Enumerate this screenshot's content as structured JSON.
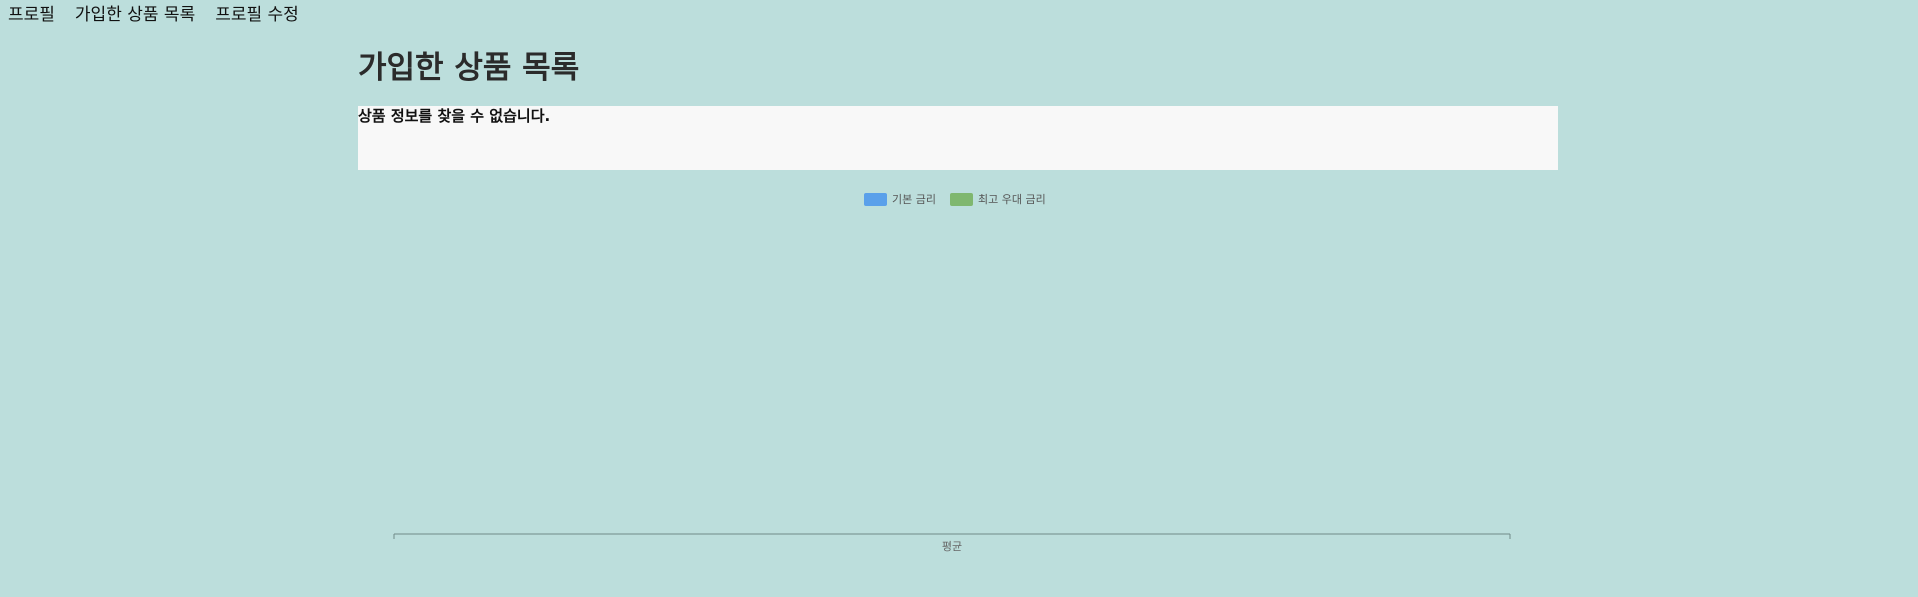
{
  "nav": {
    "items": [
      {
        "label": "프로필"
      },
      {
        "label": "가입한 상품 목록"
      },
      {
        "label": "프로필 수정"
      }
    ]
  },
  "page": {
    "title": "가입한 상품 목록",
    "message": "상품 정보를 찾을 수 없습니다."
  },
  "colors": {
    "background": "#bcdedc",
    "panel": "#f8f8f8",
    "base_rate": "#5aa0ea",
    "max_rate": "#7fb76f"
  },
  "chart_data": {
    "type": "bar",
    "categories": [
      "평균"
    ],
    "series": [
      {
        "name": "기본 금리",
        "values": [],
        "color": "#5aa0ea"
      },
      {
        "name": "최고 우대 금리",
        "values": [],
        "color": "#7fb76f"
      }
    ],
    "legend_position": "top-center",
    "grid": false
  }
}
